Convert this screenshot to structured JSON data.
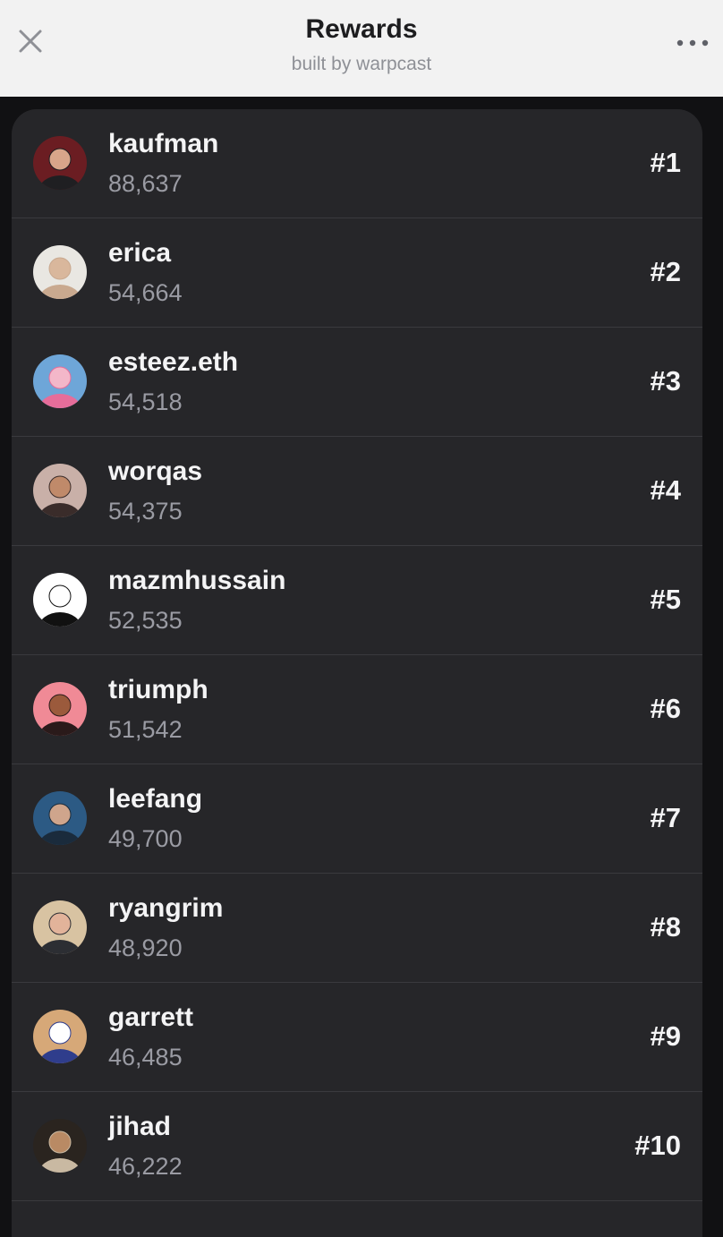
{
  "header": {
    "title": "Rewards",
    "subtitle": "built by warpcast",
    "close_icon": "close-icon",
    "more_icon": "more-horizontal-icon"
  },
  "leaderboard": [
    {
      "name": "kaufman",
      "score": "88,637",
      "rank": "#1",
      "avatar": {
        "bg": "#6b1d22",
        "skin": "#d8a58a",
        "body": "#1f1f22"
      }
    },
    {
      "name": "erica",
      "score": "54,664",
      "rank": "#2",
      "avatar": {
        "bg": "#e9e7e2",
        "skin": "#d9b79c",
        "body": "#c9a98f"
      }
    },
    {
      "name": "esteez.eth",
      "score": "54,518",
      "rank": "#3",
      "avatar": {
        "bg": "#6ea6d8",
        "skin": "#f3b7c9",
        "body": "#e66d9a"
      }
    },
    {
      "name": "worqas",
      "score": "54,375",
      "rank": "#4",
      "avatar": {
        "bg": "#c9b0a8",
        "skin": "#c08a6a",
        "body": "#3a2c2a"
      }
    },
    {
      "name": "mazmhussain",
      "score": "52,535",
      "rank": "#5",
      "avatar": {
        "bg": "#ffffff",
        "skin": "#ffffff",
        "body": "#111111"
      }
    },
    {
      "name": "triumph",
      "score": "51,542",
      "rank": "#6",
      "avatar": {
        "bg": "#f08a96",
        "skin": "#9b5a3c",
        "body": "#2a1a1a"
      }
    },
    {
      "name": "leefang",
      "score": "49,700",
      "rank": "#7",
      "avatar": {
        "bg": "#2c5a84",
        "skin": "#cfa58c",
        "body": "#1a2b3c"
      }
    },
    {
      "name": "ryangrim",
      "score": "48,920",
      "rank": "#8",
      "avatar": {
        "bg": "#d8c3a2",
        "skin": "#e2b39a",
        "body": "#2c2e33"
      }
    },
    {
      "name": "garrett",
      "score": "46,485",
      "rank": "#9",
      "avatar": {
        "bg": "#d6a878",
        "skin": "#ffffff",
        "body": "#2f3d8c"
      }
    },
    {
      "name": "jihad",
      "score": "46,222",
      "rank": "#10",
      "avatar": {
        "bg": "#2a241f",
        "skin": "#b98a64",
        "body": "#c9b9a2"
      }
    }
  ],
  "colors": {
    "header_bg": "#f2f2f2",
    "list_bg": "#262629",
    "page_bg": "#111113",
    "name_text": "#f4f4f5",
    "score_text": "#9a9ba3"
  }
}
